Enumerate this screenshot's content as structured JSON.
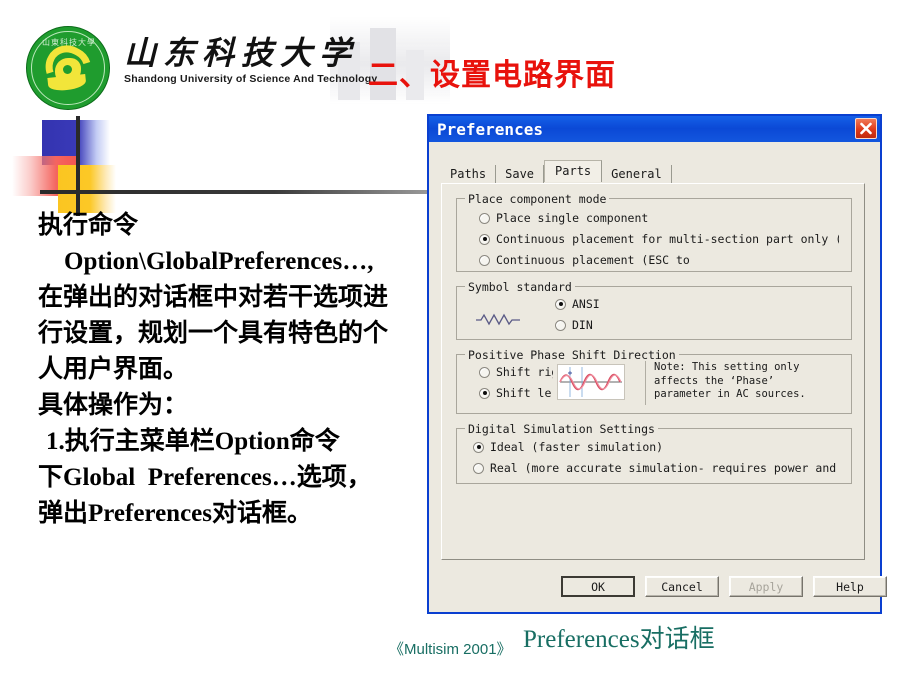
{
  "slide": {
    "title": "二、设置电路界面",
    "title_color": "#e8120c",
    "logo": {
      "name": "shandong-university-emblem",
      "inner_chars": "山東科技大學"
    },
    "wordmark": {
      "chinese": "山东科技大学",
      "english": "Shandong University of Science And Technology"
    },
    "body_lines": [
      "执行命令",
      "Option\\GlobalPreferences…,",
      "在弹出的对话框中对若干选项进",
      "行设置，规划一个具有特色的个",
      "人用户界面。",
      "具体操作为：",
      "1.执行主菜单栏Option命令",
      "下Global  Preferences…选项，",
      "弹出Preferences对话框。"
    ],
    "caption_dialog": "Preferences对话框",
    "caption_source": "《Multisim 2001》",
    "caption_color": "#186e63"
  },
  "dialog": {
    "title": "Preferences",
    "titlebar_color": "#0b49d6",
    "close_icon": "close-icon",
    "tabs": [
      {
        "label": "Paths",
        "active": false
      },
      {
        "label": "Save",
        "active": false
      },
      {
        "label": "Parts",
        "active": true
      },
      {
        "label": "General",
        "active": false
      }
    ],
    "groups": {
      "place_component_mode": {
        "legend": "Place component mode",
        "options": [
          {
            "label": "Place single component",
            "selected": false
          },
          {
            "label": "Continuous placement for multi-section part only (ES",
            "selected": true
          },
          {
            "label": "Continuous placement (ESC to",
            "selected": false
          }
        ]
      },
      "symbol_standard": {
        "legend": "Symbol standard",
        "icon": "resistor-symbol-icon",
        "options": [
          {
            "label": "ANSI",
            "selected": true
          },
          {
            "label": "DIN",
            "selected": false
          }
        ]
      },
      "positive_phase_shift_direction": {
        "legend": "Positive Phase Shift Direction",
        "options": [
          {
            "label": "Shift rig",
            "selected": false
          },
          {
            "label": "Shift le",
            "selected": true
          }
        ],
        "preview_icon": "sine-wave-preview",
        "note": "Note: This setting only\naffects the ‘Phase’\nparameter in AC sources."
      },
      "digital_simulation_settings": {
        "legend": "Digital Simulation Settings",
        "options": [
          {
            "label": "Ideal (faster simulation)",
            "selected": true
          },
          {
            "label": "Real (more accurate simulation- requires power and di",
            "selected": false
          }
        ]
      }
    },
    "buttons": [
      {
        "id": "ok",
        "label": "OK",
        "mnemonic": "O",
        "state": "default"
      },
      {
        "id": "cancel",
        "label": "Cancel",
        "mnemonic": "C",
        "state": "normal"
      },
      {
        "id": "apply",
        "label": "Apply",
        "mnemonic": "A",
        "state": "disabled"
      },
      {
        "id": "help",
        "label": "Help",
        "mnemonic": "H",
        "state": "normal"
      }
    ]
  }
}
